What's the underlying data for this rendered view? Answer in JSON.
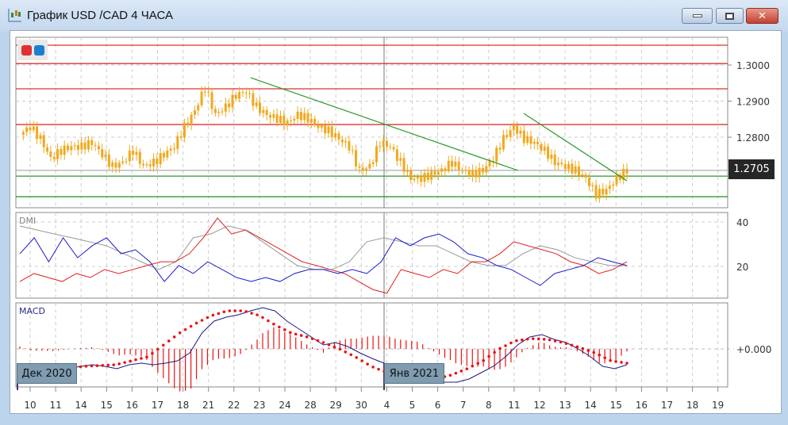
{
  "window": {
    "title": "График USD /CAD  4 ЧАСА",
    "buttons": [
      "minimize",
      "maximize",
      "close"
    ],
    "close_glyph": "✕"
  },
  "colors": {
    "candle": "#f2a81d",
    "resistance": "#e03030",
    "support": "#2a9a2a",
    "trend": "#2a9a2a",
    "dmi_plus": "#1a1acc",
    "dmi_minus": "#e02020",
    "adx": "#999999",
    "macd": "#1a1a80",
    "signal": "#ee1111",
    "hist": "#ee1111",
    "theme_red": "#e03030",
    "theme_blue": "#1a7fd0"
  },
  "price_axis": {
    "labels": [
      "1.3000",
      "1.2900",
      "1.2800"
    ],
    "values": [
      1.3,
      1.29,
      1.28
    ],
    "current": "1.2705"
  },
  "dmi": {
    "label": "DMI",
    "axis_labels": [
      "40",
      "20"
    ],
    "axis_values": [
      40,
      20
    ]
  },
  "macd": {
    "label": "MACD",
    "zero_label": "+0.000"
  },
  "months": [
    "Дек 2020",
    "Янв 2021"
  ],
  "chart_data": {
    "type": "line",
    "title": "USD/CAD 4H",
    "x_tick_labels": [
      "10",
      "11",
      "14",
      "15",
      "16",
      "17",
      "18",
      "21",
      "22",
      "23",
      "24",
      "28",
      "29",
      "30",
      "4",
      "5",
      "6",
      "7",
      "8",
      "11",
      "12",
      "13",
      "14",
      "15",
      "16",
      "17",
      "18",
      "19"
    ],
    "series_day_range": [
      -0.4,
      23.2
    ],
    "price_closes": [
      1.2807,
      1.2829,
      1.2796,
      1.2741,
      1.2763,
      1.2774,
      1.2774,
      1.2785,
      1.2752,
      1.2719,
      1.273,
      1.2763,
      1.2719,
      1.273,
      1.2752,
      1.2774,
      1.2829,
      1.2873,
      1.2938,
      1.2862,
      1.2884,
      1.2916,
      1.2927,
      1.2884,
      1.2862,
      1.2851,
      1.284,
      1.2862,
      1.2851,
      1.2829,
      1.2818,
      1.2796,
      1.2774,
      1.2708,
      1.2719,
      1.2785,
      1.2774,
      1.273,
      1.2686,
      1.2686,
      1.2697,
      1.2708,
      1.273,
      1.2708,
      1.2697,
      1.2708,
      1.2741,
      1.2796,
      1.2829,
      1.2796,
      1.2785,
      1.2763,
      1.273,
      1.2719,
      1.2708,
      1.2686,
      1.2642,
      1.2653,
      1.2686,
      1.2708
    ],
    "horizontal_levels": {
      "resistance": [
        1.3055,
        1.3004,
        1.2934,
        1.2835
      ],
      "support": [
        1.2692,
        1.2635
      ],
      "current": 1.2708
    },
    "trendlines": [
      {
        "from": [
          0.38,
          1.2965
        ],
        "to": [
          0.82,
          1.2708
        ]
      },
      {
        "from": [
          0.83,
          1.2866
        ],
        "to": [
          1.0,
          1.2679
        ]
      }
    ],
    "dmi_plus": [
      25.7,
      32.9,
      22.1,
      32.9,
      23.9,
      29.3,
      32.9,
      25.7,
      27.5,
      22.1,
      13.2,
      20.4,
      16.8,
      22.1,
      18.6,
      15,
      13.2,
      15,
      13.2,
      16.8,
      18.6,
      18.6,
      16.8,
      18.6,
      16.8,
      22.1,
      32.9,
      29.3,
      32.9,
      34.6,
      31.1,
      25.7,
      23.9,
      20.4,
      18.6,
      15,
      11.4,
      16.8,
      18.6,
      20.4,
      23.9,
      22.1,
      20.4
    ],
    "dmi_minus": [
      13.2,
      16.8,
      15,
      13.2,
      16.8,
      15,
      18.6,
      16.8,
      18.6,
      20.4,
      22.1,
      22.1,
      25.7,
      32.9,
      41.8,
      34.6,
      36.4,
      32.9,
      29.3,
      25.7,
      22.1,
      20.4,
      18.6,
      16.8,
      13.2,
      9.6,
      7.9,
      18.6,
      16.8,
      15,
      18.6,
      16.8,
      22.1,
      22.1,
      25.7,
      31.1,
      29.3,
      27.5,
      25.7,
      22.1,
      20.4,
      16.8,
      18.6,
      22.1
    ],
    "adx": [
      38.2,
      36.4,
      34.6,
      32.9,
      31.1,
      29.3,
      25.7,
      22.1,
      18.6,
      22.1,
      32.9,
      34.6,
      38.2,
      36.4,
      31.1,
      25.7,
      20.4,
      18.6,
      18.6,
      22.1,
      31.1,
      32.9,
      31.1,
      29.3,
      29.3,
      25.7,
      22.1,
      20.4,
      20.4,
      25.7,
      29.3,
      27.5,
      23.9,
      22.1,
      20.4,
      20.4
    ],
    "macd_x1000": [
      -3.0,
      -3.2,
      -3.0,
      -2.8,
      -2.5,
      -2.2,
      -2.0,
      -2.2,
      -2.5,
      -2.0,
      -1.8,
      -2.0,
      -1.8,
      -1.5,
      -0.5,
      2.0,
      3.5,
      4.0,
      4.3,
      4.8,
      5.2,
      4.8,
      3.5,
      2.5,
      1.5,
      0.5,
      0.8,
      0.3,
      -0.5,
      -1.2,
      -1.8,
      -2.5,
      -3.0,
      -3.5,
      -4.0,
      -4.2,
      -4.2,
      -3.8,
      -3.0,
      -2.2,
      -1.0,
      0.5,
      1.5,
      1.8,
      1.2,
      0.8,
      0,
      -1.0,
      -2.2,
      -2.5,
      -2.0
    ],
    "signal_x1000": [
      -3.2,
      -3.0,
      -2.7,
      -2.5,
      -2.2,
      -2.1,
      -2.0,
      -1.5,
      -1.0,
      0.5,
      2.0,
      3.2,
      4.2,
      4.8,
      4.8,
      4.2,
      3.0,
      2.0,
      1.5,
      0.8,
      0,
      -1.0,
      -2.2,
      -3.0,
      -3.5,
      -4.0,
      -3.8,
      -3.3,
      -2.5,
      -1.5,
      0,
      1.0,
      1.3,
      1.2,
      0.8,
      0.2,
      -0.5,
      -1.5,
      -1.8
    ]
  }
}
